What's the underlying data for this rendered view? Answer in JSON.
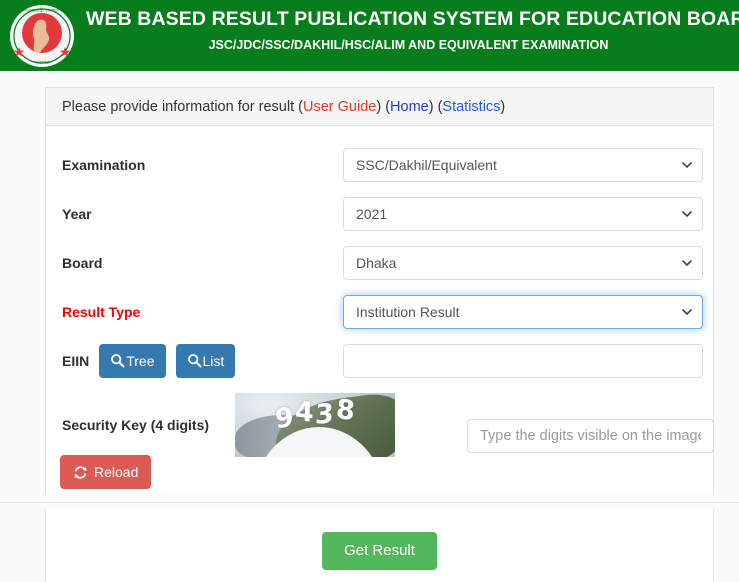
{
  "banner": {
    "title": "WEB BASED RESULT PUBLICATION SYSTEM FOR EDUCATION BOARDS",
    "subtitle": "JSC/JDC/SSC/DAKHIL/HSC/ALIM AND EQUIVALENT EXAMINATION",
    "logo_icon": "bangladesh-government-emblem",
    "background_color": "#087d1c"
  },
  "panel": {
    "heading": {
      "intro": "Please provide information for result ",
      "open_paren": "(",
      "user_guide": "User Guide",
      "close_paren_1": ") (",
      "home": "Home",
      "close_paren_2": ") (",
      "statistics": "Statistics",
      "close_paren_3": ")",
      "user_guide_color": "#e8381f",
      "home_color": "#2b39c9",
      "statistics_color": "#1f5fd8"
    },
    "fields": {
      "examination": {
        "label": "Examination",
        "value": "SSC/Dakhil/Equivalent",
        "focused": false
      },
      "year": {
        "label": "Year",
        "value": "2021",
        "focused": false
      },
      "board": {
        "label": "Board",
        "value": "Dhaka",
        "focused": false
      },
      "result_type": {
        "label": "Result Type",
        "value": "Institution Result",
        "focused": true,
        "label_color": "#ff0000"
      },
      "eiin": {
        "label": "EIIN",
        "value": "",
        "placeholder": "",
        "buttons": [
          {
            "label": "Tree",
            "icon": "search-icon",
            "color": "#3479b0"
          },
          {
            "label": "List",
            "icon": "search-icon",
            "color": "#3479b0"
          }
        ]
      },
      "security_key": {
        "label": "Security Key (4 digits)",
        "captcha_digits": "9438",
        "captcha_digit_list": [
          "9",
          "4",
          "3",
          "8"
        ],
        "reload_button": {
          "label": "Reload",
          "icon": "refresh-icon",
          "color": "#db5b56"
        },
        "input_value": "",
        "input_placeholder": "Type the digits visible on the image"
      }
    }
  },
  "footer": {
    "submit_button": {
      "label": "Get Result",
      "color": "#53b85b"
    }
  }
}
